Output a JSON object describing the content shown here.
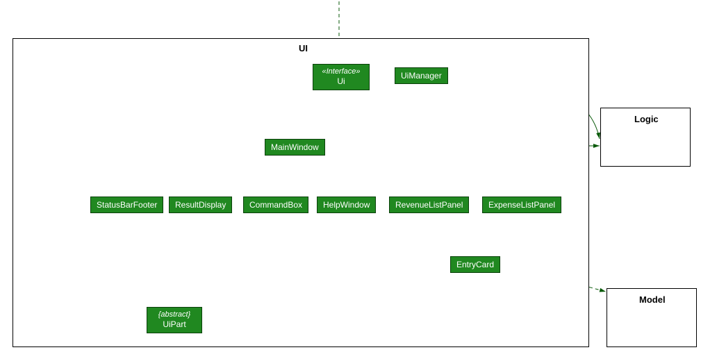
{
  "package": {
    "title": "UI"
  },
  "externals": {
    "logic": "Logic",
    "model": "Model"
  },
  "nodes": {
    "ui_interface": {
      "stereo": "«Interface»",
      "name": "Ui"
    },
    "ui_manager": "UiManager",
    "main_window": "MainWindow",
    "status_bar_footer": "StatusBarFooter",
    "result_display": "ResultDisplay",
    "command_box": "CommandBox",
    "help_window": "HelpWindow",
    "revenue_list_panel": "RevenueListPanel",
    "expense_list_panel": "ExpenseListPanel",
    "entry_card": "EntryCard",
    "ui_part": {
      "stereo": "{abstract}",
      "name": "UiPart"
    }
  }
}
